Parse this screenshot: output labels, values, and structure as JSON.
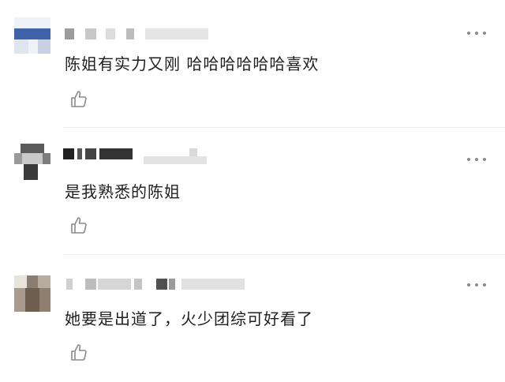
{
  "comments": [
    {
      "text": "陈姐有实力又刚 哈哈哈哈哈哈喜欢",
      "more_icon": "more-horizontal-icon",
      "like_icon": "thumbs-up-icon"
    },
    {
      "text": "是我熟悉的陈姐",
      "more_icon": "more-horizontal-icon",
      "like_icon": "thumbs-up-icon"
    },
    {
      "text": "她要是出道了，火少团综可好看了",
      "more_icon": "more-horizontal-icon",
      "like_icon": "thumbs-up-icon"
    }
  ],
  "colors": {
    "text": "#1f1f1f",
    "icon": "#8a8a8a",
    "divider": "#ececec"
  }
}
